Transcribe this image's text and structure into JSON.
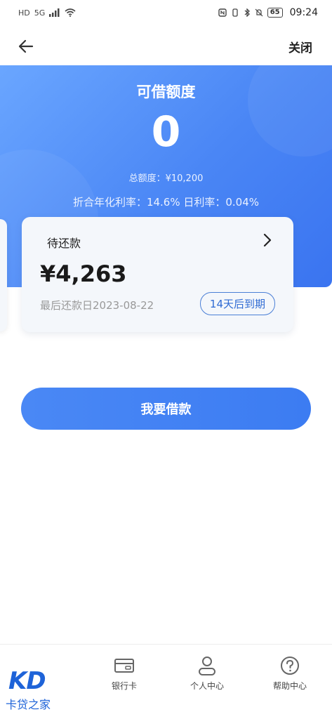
{
  "status_bar": {
    "left_icons": [
      "HD",
      "5G",
      "signal-icon",
      "wifi-icon"
    ],
    "battery": "65",
    "time": "09:24"
  },
  "nav": {
    "close_label": "关闭"
  },
  "hero": {
    "title": "可借额度",
    "amount": "0",
    "total_limit": "总额度：¥10,200",
    "rates": "折合年化利率：14.6%   日利率：0.04%"
  },
  "repay_card": {
    "label": "待还款",
    "amount": "¥4,263",
    "last_date": "最后还款日2023-08-22",
    "due_badge": "14天后到期"
  },
  "borrow_button": {
    "label": "我要借款"
  },
  "tabs": [
    {
      "label": "",
      "icon": "home-icon"
    },
    {
      "label": "银行卡",
      "icon": "bank-card-icon"
    },
    {
      "label": "个人中心",
      "icon": "user-icon"
    },
    {
      "label": "帮助中心",
      "icon": "help-icon"
    }
  ],
  "watermark": {
    "logo": "KD",
    "text": "卡贷之家"
  },
  "colors": {
    "primary": "#4a86f5",
    "badge_border": "#4a7fd6"
  }
}
